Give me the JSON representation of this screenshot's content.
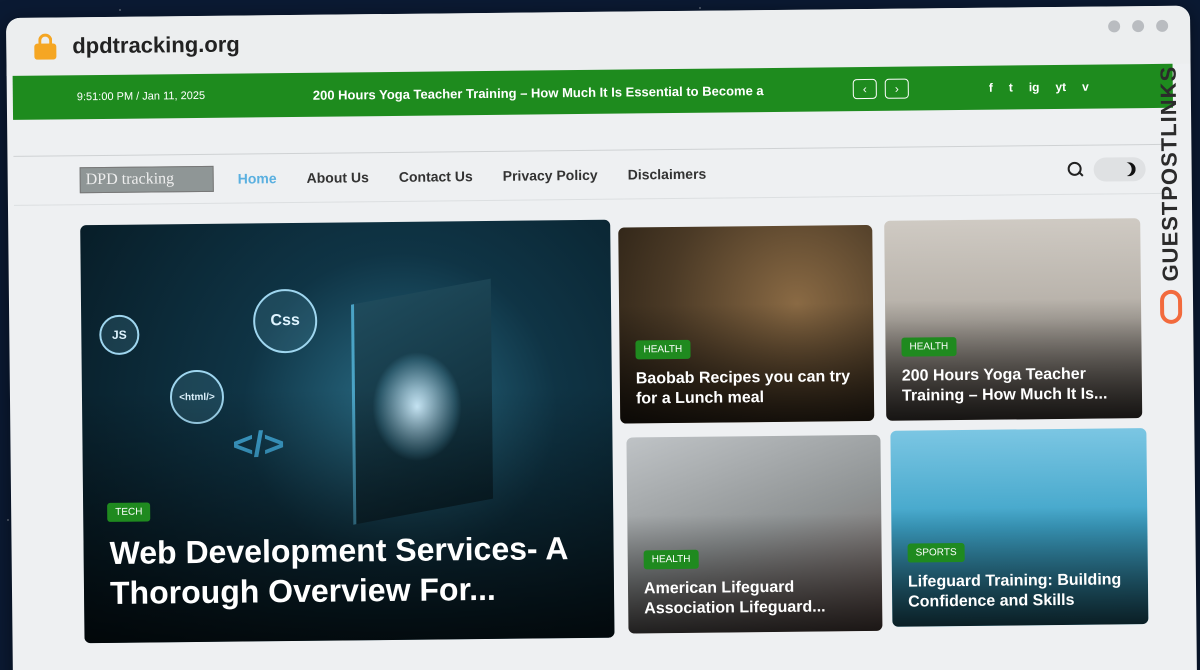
{
  "browser": {
    "url": "dpdtracking.org"
  },
  "topbar": {
    "datetime": "9:51:00 PM / Jan 11, 2025",
    "ticker": "200 Hours Yoga Teacher Training – How Much It Is Essential to Become a",
    "prev": "‹",
    "next": "›",
    "social": [
      "f",
      "t",
      "ig",
      "yt",
      "v"
    ]
  },
  "nav": {
    "logo": "DPD tracking",
    "items": [
      "Home",
      "About Us",
      "Contact Us",
      "Privacy Policy",
      "Disclaimers"
    ]
  },
  "featured": {
    "category": "TECH",
    "title": "Web Development Services- A Thorough Overview For...",
    "bubbles": [
      "JS",
      "Css",
      "<html/>"
    ],
    "code": "</>"
  },
  "cards": [
    {
      "category": "HEALTH",
      "title": "Baobab Recipes you can try for a Lunch meal"
    },
    {
      "category": "HEALTH",
      "title": "200 Hours Yoga Teacher Training – How Much It Is..."
    },
    {
      "category": "HEALTH",
      "title": "American Lifeguard Association Lifeguard..."
    },
    {
      "category": "SPORTS",
      "title": "Lifeguard Training: Building Confidence and Skills"
    }
  ],
  "side_brand": "GUESTPOSTLINKS",
  "colors": {
    "accent": "#1e8b1e",
    "active_link": "#5ab0e0",
    "brand_orange": "#f26a3d"
  }
}
